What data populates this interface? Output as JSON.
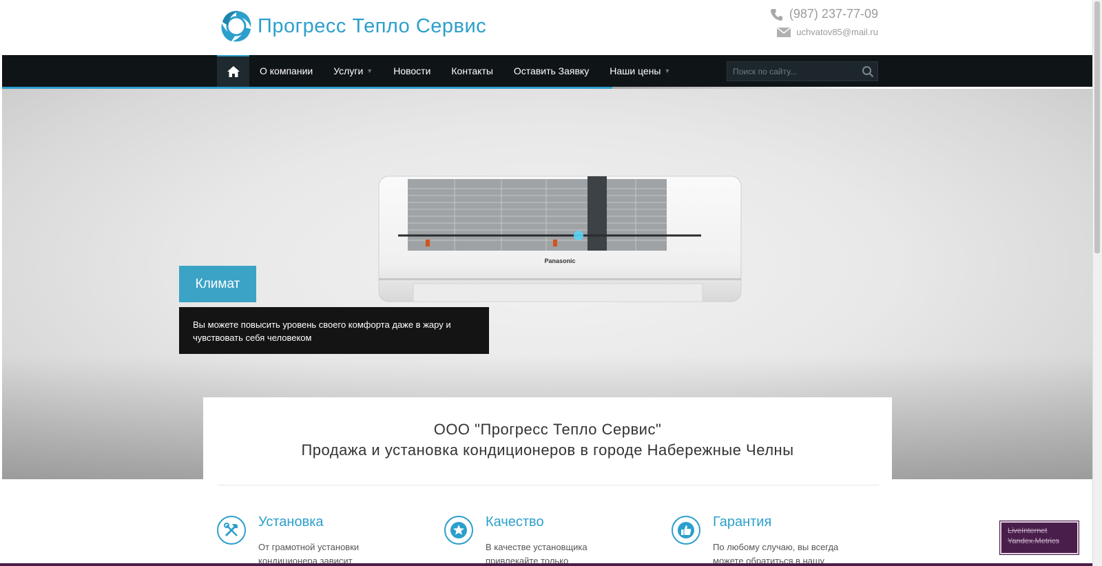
{
  "header": {
    "logo_text": "Прогресс Тепло Сервис",
    "phone": "(987) 237-77-09",
    "email": "uchvatov85@mail.ru"
  },
  "nav": {
    "items": [
      {
        "label": "О компании",
        "has_dropdown": false
      },
      {
        "label": "Услуги",
        "has_dropdown": true
      },
      {
        "label": "Новости",
        "has_dropdown": false
      },
      {
        "label": "Контакты",
        "has_dropdown": false
      },
      {
        "label": "Оставить Заявку",
        "has_dropdown": false
      },
      {
        "label": "Наши цены",
        "has_dropdown": true
      }
    ],
    "search_placeholder": "Поиск по сайту..."
  },
  "slider": {
    "title": "Климат",
    "caption": "Вы можете повысить уровень своего комфорта даже в жару и чувствовать себя человеком",
    "product_brand": "Panasonic"
  },
  "company": {
    "line1": "ООО \"Прогресс Тепло Сервис\"",
    "line2": "Продажа и установка кондиционеров в городе Набережные Челны"
  },
  "features": [
    {
      "title": "Установка",
      "text": "От грамотной установки кондиционера зависит",
      "icon": "tools-icon"
    },
    {
      "title": "Качество",
      "text": "В качестве установщика привлекайте только",
      "icon": "star-icon"
    },
    {
      "title": "Гарантия",
      "text": "По любому случаю, вы всегда можете обратиться в нашу",
      "icon": "thumbs-up-icon"
    }
  ],
  "badge": {
    "line1": "LiveInternet",
    "line2": "Yandex.Metrics"
  },
  "colors": {
    "accent": "#2c9fcc",
    "nav_bg": "#0f1417",
    "slide_title_bg": "#3ba3c6",
    "caption_bg": "#141414",
    "badge_bg": "#4a1e4b"
  }
}
